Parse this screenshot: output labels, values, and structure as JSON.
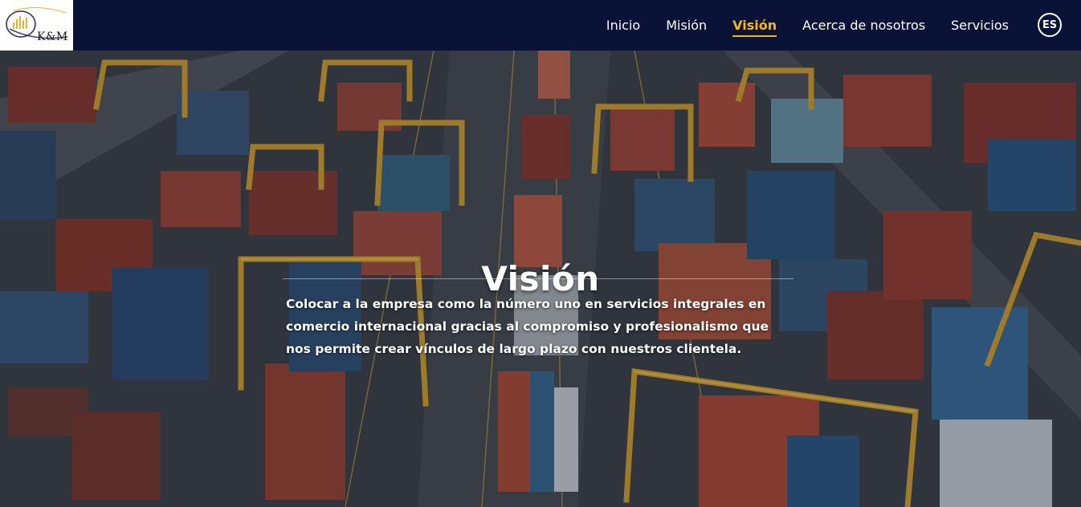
{
  "brand": {
    "logo_text": "K&M"
  },
  "nav": {
    "items": [
      {
        "label": "Inicio",
        "active": false
      },
      {
        "label": "Misión",
        "active": false
      },
      {
        "label": "Visión",
        "active": true
      },
      {
        "label": "Acerca de nosotros",
        "active": false
      },
      {
        "label": "Servicios",
        "active": false
      }
    ],
    "language": "ES"
  },
  "hero": {
    "title": "Visión",
    "text": "Colocar a la empresa como la número uno en servicios integrales en comercio internacional gracias al compromiso y profesionalismo que nos permite crear vínculos de largo plazo con nuestros clientela."
  },
  "colors": {
    "header_bg": "#0b1238",
    "accent": "#f5b80f",
    "text": "#ffffff"
  }
}
